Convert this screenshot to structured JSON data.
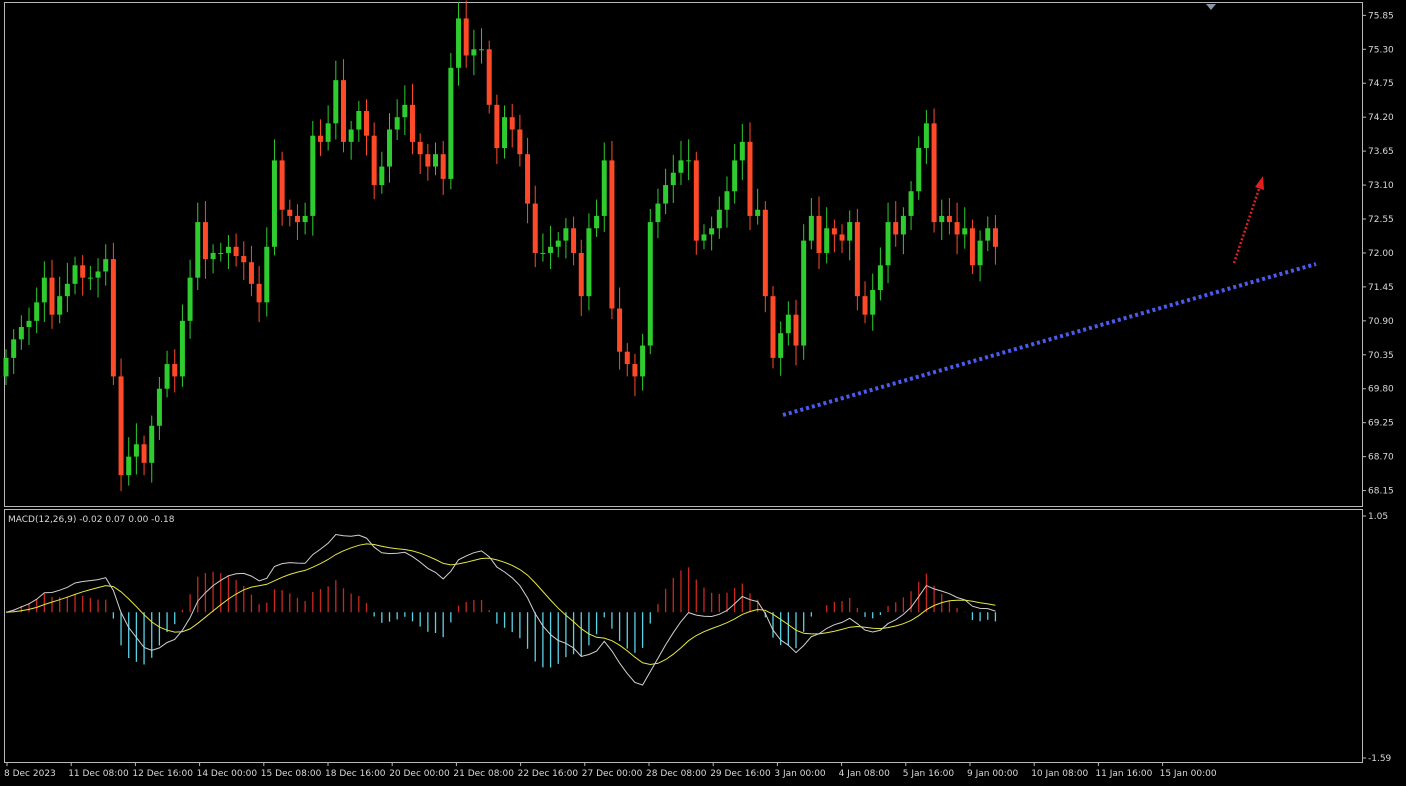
{
  "colors": {
    "background": "#000000",
    "frame": "#b8b8b8",
    "bull": "#2ecc2e",
    "bear": "#ff4a2a",
    "trendline": "#4a5cf0",
    "arrow": "#e02020",
    "hist_pos": "#c8281e",
    "hist_neg": "#5ad2e6",
    "macd_line": "#d0d0d0",
    "signal_line": "#e6e640"
  },
  "chart_data": [
    {
      "type": "candlestick",
      "ylim": [
        67.9,
        76.05
      ],
      "y_ticks": [
        "75.85",
        "75.30",
        "74.75",
        "74.20",
        "73.65",
        "73.10",
        "72.55",
        "72.00",
        "71.45",
        "70.90",
        "70.35",
        "69.80",
        "69.25",
        "68.70",
        "68.15"
      ],
      "x_ticks": [
        "8 Dec 2023",
        "11 Dec 08:00",
        "12 Dec 16:00",
        "14 Dec 00:00",
        "15 Dec 08:00",
        "18 Dec 16:00",
        "20 Dec 00:00",
        "21 Dec 08:00",
        "22 Dec 16:00",
        "27 Dec 00:00",
        "28 Dec 08:00",
        "29 Dec 16:00",
        "3 Jan 00:00",
        "4 Jan 08:00",
        "5 Jan 16:00",
        "9 Jan 00:00",
        "10 Jan 08:00",
        "11 Jan 16:00",
        "15 Jan 00:00"
      ],
      "closes": [
        70.3,
        70.6,
        70.8,
        70.9,
        71.2,
        71.6,
        71.0,
        71.3,
        71.5,
        71.8,
        71.6,
        71.6,
        71.7,
        71.9,
        70.0,
        68.4,
        68.7,
        68.9,
        68.6,
        69.2,
        69.8,
        70.2,
        70.0,
        70.9,
        71.6,
        72.5,
        71.9,
        72.0,
        72.0,
        72.1,
        71.95,
        71.85,
        71.5,
        71.2,
        72.1,
        73.5,
        72.7,
        72.6,
        72.5,
        72.6,
        73.9,
        73.8,
        74.1,
        74.8,
        73.8,
        74.0,
        74.3,
        73.9,
        73.1,
        73.4,
        74.0,
        74.2,
        74.4,
        73.8,
        73.6,
        73.4,
        73.6,
        73.2,
        75.0,
        75.8,
        75.2,
        75.3,
        75.3,
        74.4,
        73.7,
        74.2,
        74.0,
        73.6,
        72.8,
        72.0,
        72.0,
        72.1,
        72.2,
        72.4,
        72.0,
        71.3,
        72.4,
        72.6,
        73.5,
        71.1,
        70.4,
        70.2,
        70.0,
        70.5,
        72.5,
        72.8,
        73.1,
        73.3,
        73.5,
        73.5,
        72.2,
        72.3,
        72.4,
        72.7,
        73.0,
        73.5,
        73.8,
        72.6,
        72.7,
        71.3,
        70.3,
        70.7,
        71.0,
        70.5,
        72.2,
        72.6,
        72.0,
        72.4,
        72.3,
        72.2,
        72.5,
        71.3,
        71.0,
        71.4,
        71.8,
        72.5,
        72.3,
        72.6,
        73.0,
        73.7,
        74.1,
        72.5,
        72.6,
        72.5,
        72.3,
        72.4,
        71.8,
        72.2,
        72.4,
        72.1
      ]
    },
    {
      "type": "macd",
      "indicator_label": "MACD(12,26,9) -0.02 0.07 0.00 -0.18",
      "ylim": [
        -1.59,
        1.05
      ],
      "y_ticks": [
        "1.05",
        "-1.59"
      ]
    }
  ]
}
